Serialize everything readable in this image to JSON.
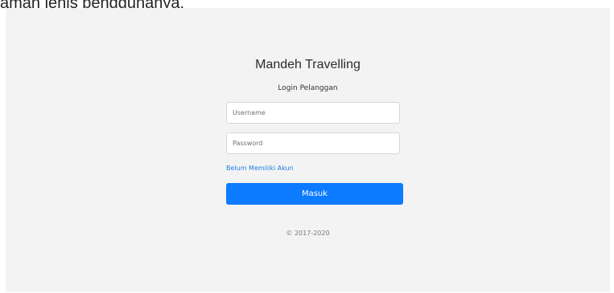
{
  "document": {
    "caption": "aman jenis penggunanya."
  },
  "login": {
    "brand": "Mandeh Travelling",
    "subtitle": "Login Pelanggan",
    "username_placeholder": "Username",
    "password_placeholder": "Password",
    "register_link": "Belum Memiliki Akun",
    "submit_label": "Masuk",
    "footer": "© 2017-2020"
  },
  "colors": {
    "accent": "#0d7bff",
    "link": "#1e7ee6",
    "background": "#f3f3f3"
  }
}
